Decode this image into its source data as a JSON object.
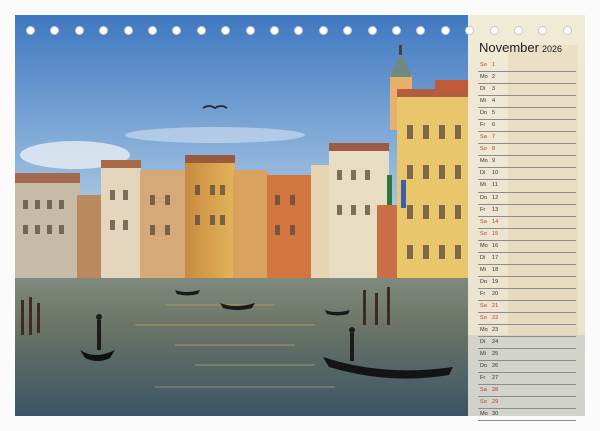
{
  "calendar": {
    "month": "November",
    "year": "2026",
    "days": [
      {
        "dow": "So",
        "num": "1",
        "weekend": true
      },
      {
        "dow": "Mo",
        "num": "2",
        "weekend": false
      },
      {
        "dow": "Di",
        "num": "3",
        "weekend": false
      },
      {
        "dow": "Mi",
        "num": "4",
        "weekend": false
      },
      {
        "dow": "Do",
        "num": "5",
        "weekend": false
      },
      {
        "dow": "Fr",
        "num": "6",
        "weekend": false
      },
      {
        "dow": "Sa",
        "num": "7",
        "weekend": true
      },
      {
        "dow": "So",
        "num": "8",
        "weekend": true
      },
      {
        "dow": "Mo",
        "num": "9",
        "weekend": false
      },
      {
        "dow": "Di",
        "num": "10",
        "weekend": false
      },
      {
        "dow": "Mi",
        "num": "11",
        "weekend": false
      },
      {
        "dow": "Do",
        "num": "12",
        "weekend": false
      },
      {
        "dow": "Fr",
        "num": "13",
        "weekend": false
      },
      {
        "dow": "Sa",
        "num": "14",
        "weekend": true
      },
      {
        "dow": "So",
        "num": "15",
        "weekend": true
      },
      {
        "dow": "Mo",
        "num": "16",
        "weekend": false
      },
      {
        "dow": "Di",
        "num": "17",
        "weekend": false
      },
      {
        "dow": "Mi",
        "num": "18",
        "weekend": false
      },
      {
        "dow": "Do",
        "num": "19",
        "weekend": false
      },
      {
        "dow": "Fr",
        "num": "20",
        "weekend": false
      },
      {
        "dow": "Sa",
        "num": "21",
        "weekend": true
      },
      {
        "dow": "So",
        "num": "22",
        "weekend": true
      },
      {
        "dow": "Mo",
        "num": "23",
        "weekend": false
      },
      {
        "dow": "Di",
        "num": "24",
        "weekend": false
      },
      {
        "dow": "Mi",
        "num": "25",
        "weekend": false
      },
      {
        "dow": "Do",
        "num": "26",
        "weekend": false
      },
      {
        "dow": "Fr",
        "num": "27",
        "weekend": false
      },
      {
        "dow": "Sa",
        "num": "28",
        "weekend": true
      },
      {
        "dow": "So",
        "num": "29",
        "weekend": true
      },
      {
        "dow": "Mo",
        "num": "30",
        "weekend": false
      }
    ]
  },
  "binding": {
    "ring_count": 23
  },
  "colors": {
    "weekend": "#c0392b",
    "text": "#333333",
    "sky": "#4f86c6",
    "water": "#4a6a7a"
  }
}
